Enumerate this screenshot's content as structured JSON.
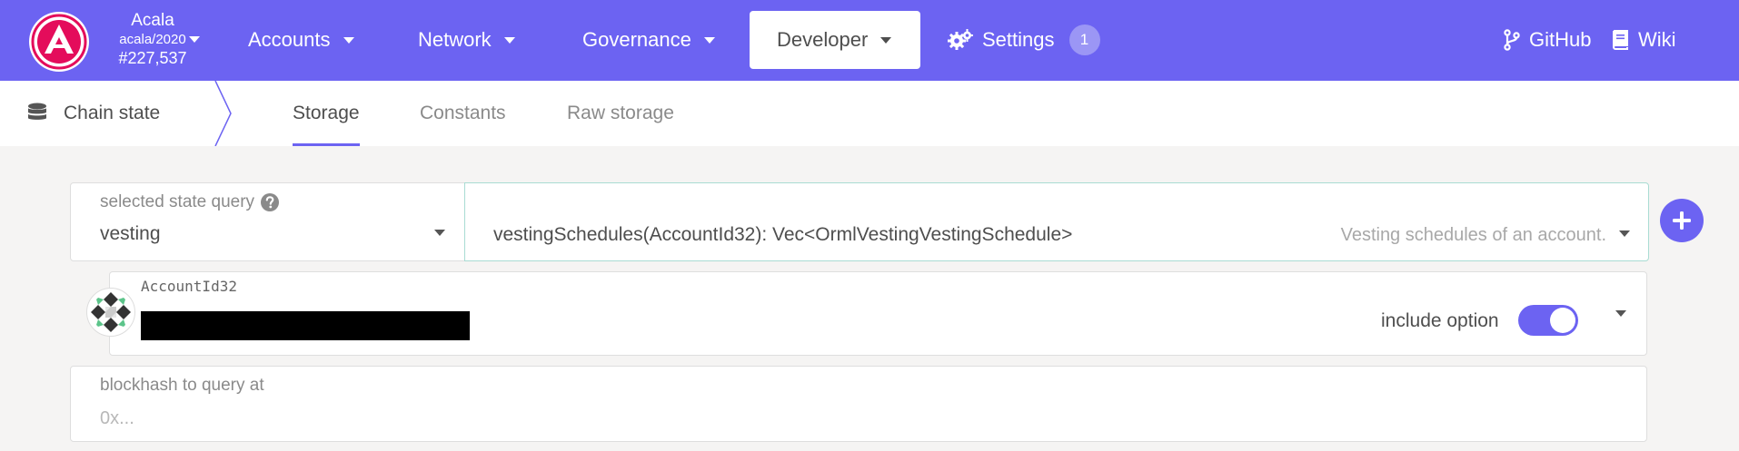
{
  "chain": {
    "name": "Acala",
    "spec": "acala/2020",
    "block": "#227,537"
  },
  "nav": {
    "items": [
      {
        "label": "Accounts"
      },
      {
        "label": "Network"
      },
      {
        "label": "Governance"
      },
      {
        "label": "Developer"
      },
      {
        "label": "Settings"
      }
    ],
    "settings_badge": "1",
    "github": "GitHub",
    "wiki": "Wiki"
  },
  "subnav": {
    "section": "Chain state",
    "tabs": [
      {
        "label": "Storage"
      },
      {
        "label": "Constants"
      },
      {
        "label": "Raw storage"
      }
    ]
  },
  "query": {
    "label": "selected state query",
    "module": "vesting",
    "method": "vestingSchedules(AccountId32): Vec<OrmlVestingVestingSchedule>",
    "description": "Vesting schedules of an account."
  },
  "account": {
    "label": "AccountId32",
    "include_option_label": "include option",
    "include_option": true
  },
  "blockhash": {
    "label": "blockhash to query at",
    "placeholder": "0x..."
  },
  "colors": {
    "brand": "#6c63f2",
    "logo_red": "#e40c5b"
  }
}
